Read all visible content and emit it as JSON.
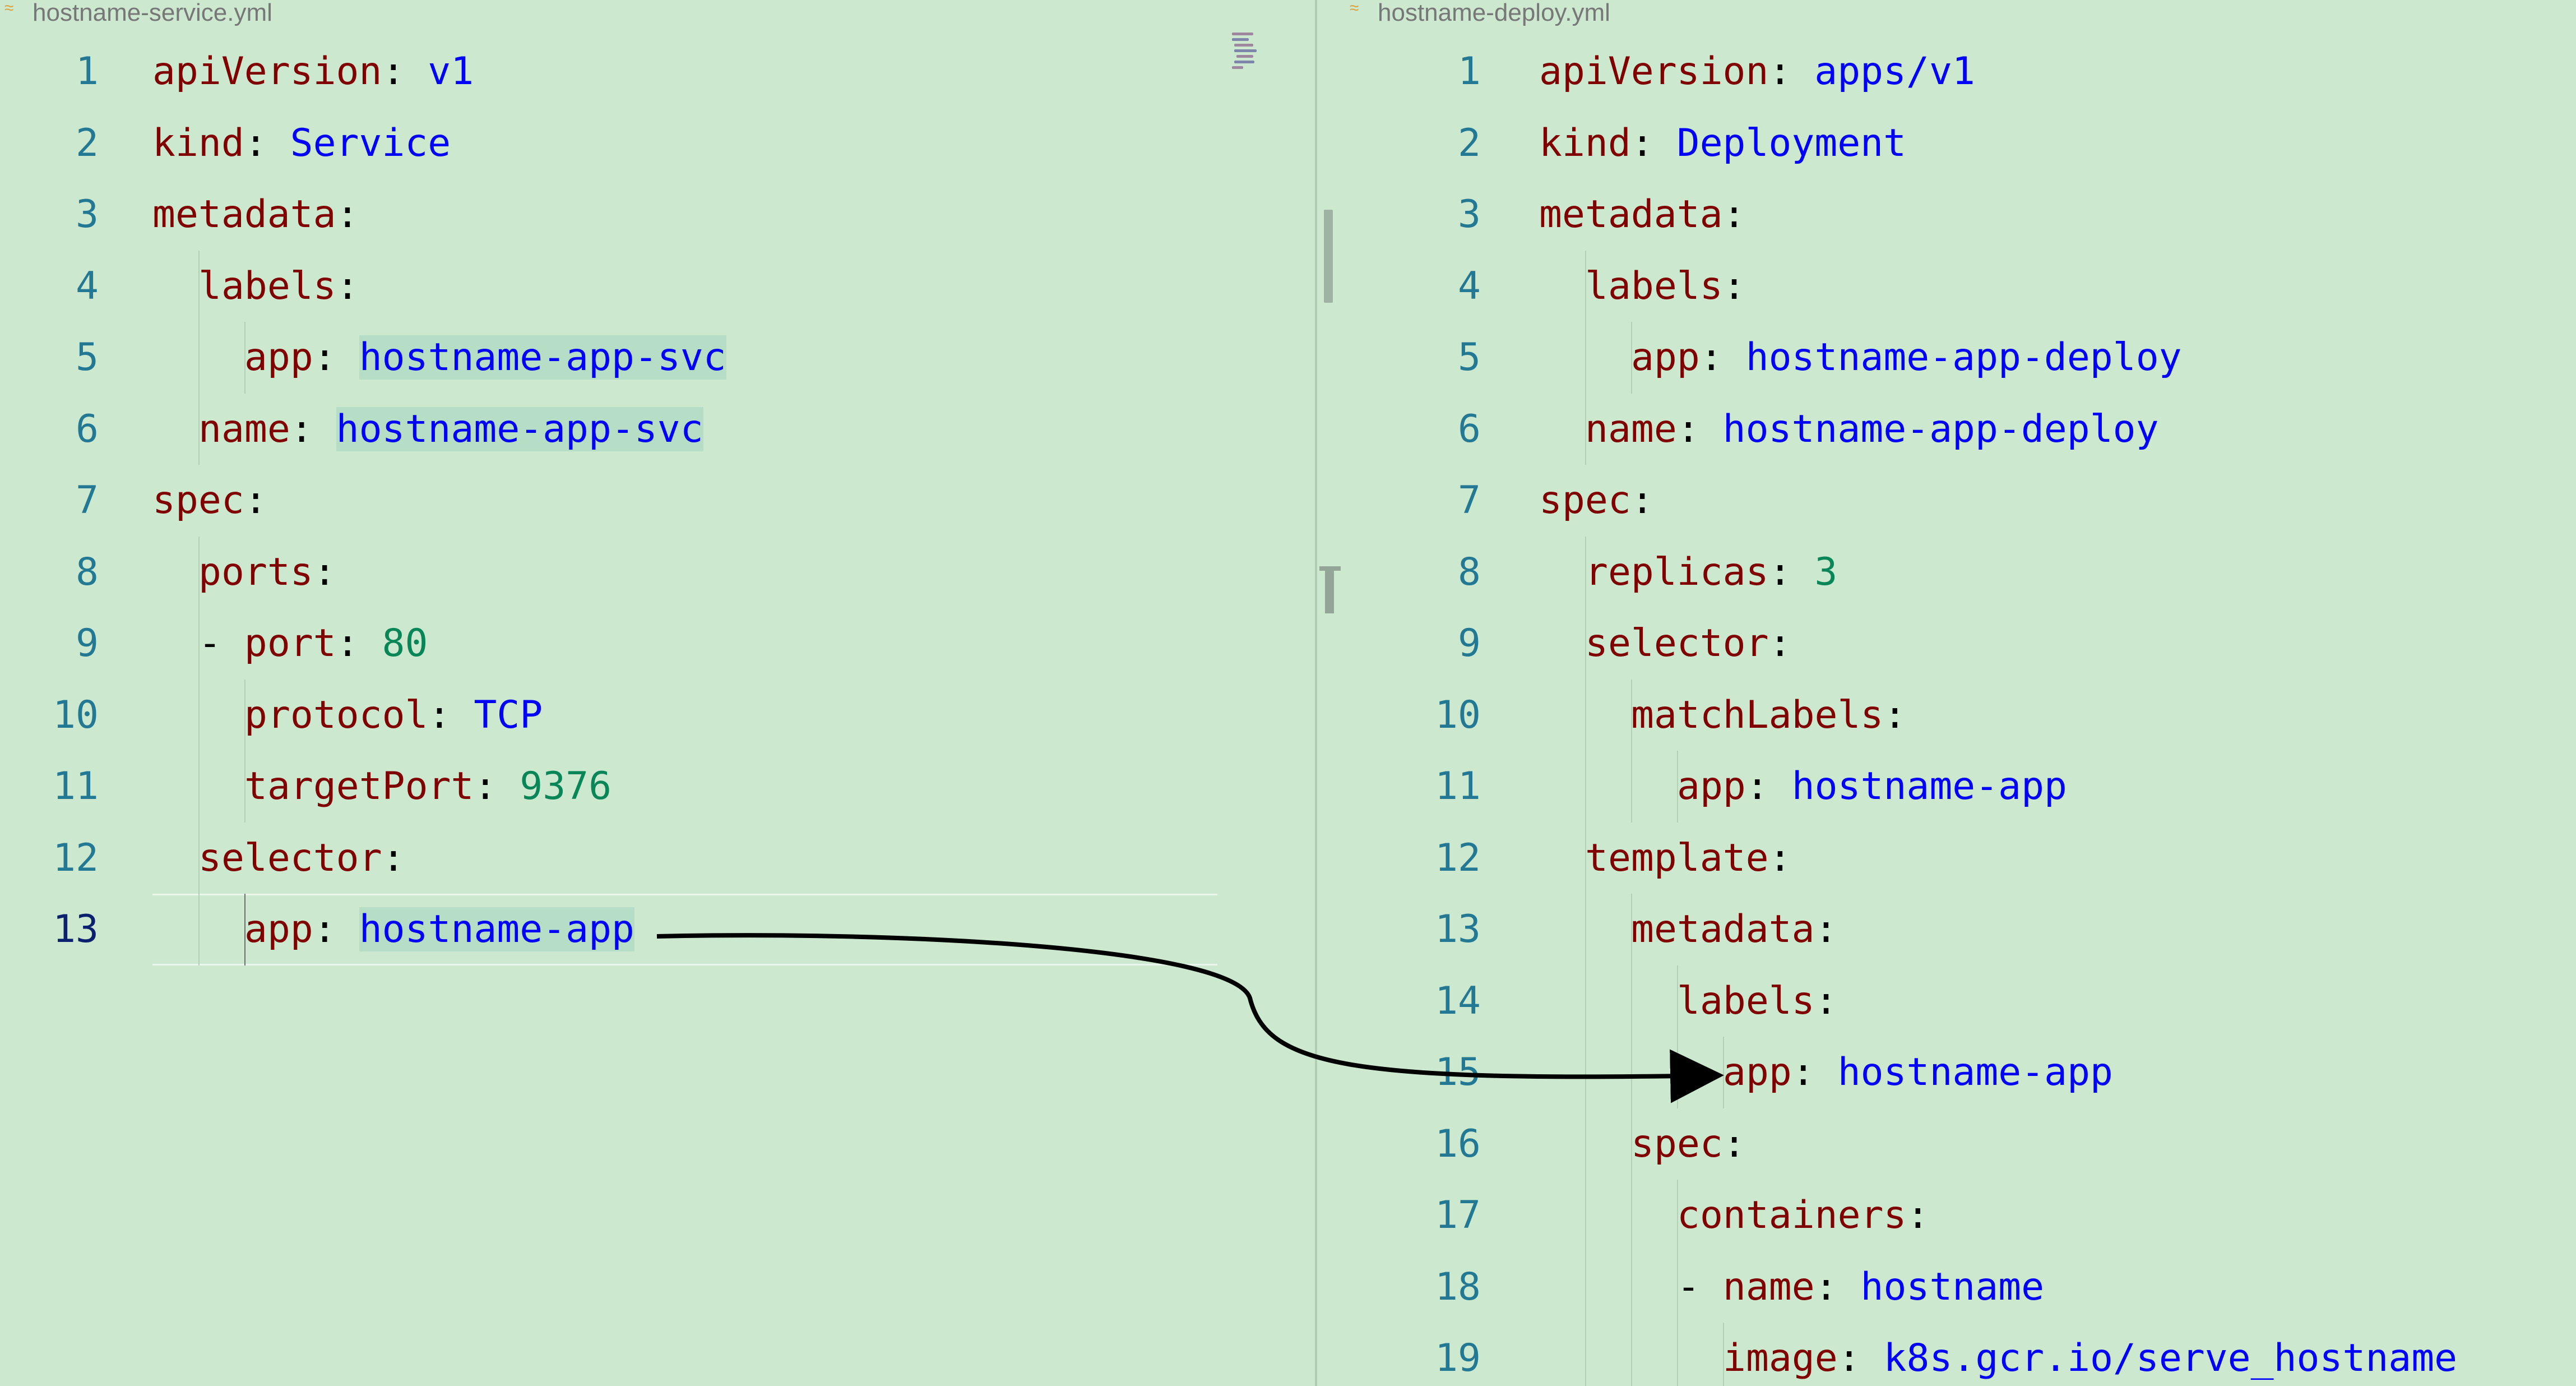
{
  "left": {
    "tab_title": "hostname-service.yml",
    "lines": [
      {
        "n": "1",
        "indent": 0,
        "tokens": [
          {
            "t": "apiVersion",
            "c": "k"
          },
          {
            "t": ": ",
            "c": "p"
          },
          {
            "t": "v1",
            "c": "s"
          }
        ]
      },
      {
        "n": "2",
        "indent": 0,
        "tokens": [
          {
            "t": "kind",
            "c": "k"
          },
          {
            "t": ": ",
            "c": "p"
          },
          {
            "t": "Service",
            "c": "s"
          }
        ]
      },
      {
        "n": "3",
        "indent": 0,
        "tokens": [
          {
            "t": "metadata",
            "c": "k"
          },
          {
            "t": ":",
            "c": "p"
          }
        ]
      },
      {
        "n": "4",
        "indent": 1,
        "tokens": [
          {
            "t": "labels",
            "c": "k"
          },
          {
            "t": ":",
            "c": "p"
          }
        ]
      },
      {
        "n": "5",
        "indent": 2,
        "tokens": [
          {
            "t": "app",
            "c": "k"
          },
          {
            "t": ": ",
            "c": "p"
          },
          {
            "t": "hostname-app-svc",
            "c": "s hl"
          }
        ]
      },
      {
        "n": "6",
        "indent": 1,
        "tokens": [
          {
            "t": "name",
            "c": "k"
          },
          {
            "t": ": ",
            "c": "p"
          },
          {
            "t": "hostname-app-svc",
            "c": "s hl"
          }
        ]
      },
      {
        "n": "7",
        "indent": 0,
        "tokens": [
          {
            "t": "spec",
            "c": "k"
          },
          {
            "t": ":",
            "c": "p"
          }
        ]
      },
      {
        "n": "8",
        "indent": 1,
        "tokens": [
          {
            "t": "ports",
            "c": "k"
          },
          {
            "t": ":",
            "c": "p"
          }
        ]
      },
      {
        "n": "9",
        "indent": 1,
        "tokens": [
          {
            "t": "- ",
            "c": "p"
          },
          {
            "t": "port",
            "c": "k"
          },
          {
            "t": ": ",
            "c": "p"
          },
          {
            "t": "80",
            "c": "n"
          }
        ]
      },
      {
        "n": "10",
        "indent": 2,
        "tokens": [
          {
            "t": "protocol",
            "c": "k"
          },
          {
            "t": ": ",
            "c": "p"
          },
          {
            "t": "TCP",
            "c": "s"
          }
        ]
      },
      {
        "n": "11",
        "indent": 2,
        "tokens": [
          {
            "t": "targetPort",
            "c": "k"
          },
          {
            "t": ": ",
            "c": "p"
          },
          {
            "t": "9376",
            "c": "n"
          }
        ]
      },
      {
        "n": "12",
        "indent": 1,
        "tokens": [
          {
            "t": "selector",
            "c": "k"
          },
          {
            "t": ":",
            "c": "p"
          }
        ]
      },
      {
        "n": "13",
        "indent": 2,
        "current": true,
        "tokens": [
          {
            "t": "app",
            "c": "k"
          },
          {
            "t": ": ",
            "c": "p"
          },
          {
            "t": "hostname-app",
            "c": "s hl"
          }
        ]
      }
    ]
  },
  "right": {
    "tab_title": "hostname-deploy.yml",
    "lines": [
      {
        "n": "1",
        "indent": 0,
        "tokens": [
          {
            "t": "apiVersion",
            "c": "k"
          },
          {
            "t": ": ",
            "c": "p"
          },
          {
            "t": "apps/v1",
            "c": "s"
          }
        ]
      },
      {
        "n": "2",
        "indent": 0,
        "tokens": [
          {
            "t": "kind",
            "c": "k"
          },
          {
            "t": ": ",
            "c": "p"
          },
          {
            "t": "Deployment",
            "c": "s"
          }
        ]
      },
      {
        "n": "3",
        "indent": 0,
        "tokens": [
          {
            "t": "metadata",
            "c": "k"
          },
          {
            "t": ":",
            "c": "p"
          }
        ]
      },
      {
        "n": "4",
        "indent": 1,
        "tokens": [
          {
            "t": "labels",
            "c": "k"
          },
          {
            "t": ":",
            "c": "p"
          }
        ]
      },
      {
        "n": "5",
        "indent": 2,
        "tokens": [
          {
            "t": "app",
            "c": "k"
          },
          {
            "t": ": ",
            "c": "p"
          },
          {
            "t": "hostname-app-deploy",
            "c": "s"
          }
        ]
      },
      {
        "n": "6",
        "indent": 1,
        "tokens": [
          {
            "t": "name",
            "c": "k"
          },
          {
            "t": ": ",
            "c": "p"
          },
          {
            "t": "hostname-app-deploy",
            "c": "s"
          }
        ]
      },
      {
        "n": "7",
        "indent": 0,
        "tokens": [
          {
            "t": "spec",
            "c": "k"
          },
          {
            "t": ":",
            "c": "p"
          }
        ]
      },
      {
        "n": "8",
        "indent": 1,
        "tokens": [
          {
            "t": "replicas",
            "c": "k"
          },
          {
            "t": ": ",
            "c": "p"
          },
          {
            "t": "3",
            "c": "n"
          }
        ]
      },
      {
        "n": "9",
        "indent": 1,
        "tokens": [
          {
            "t": "selector",
            "c": "k"
          },
          {
            "t": ":",
            "c": "p"
          }
        ]
      },
      {
        "n": "10",
        "indent": 2,
        "tokens": [
          {
            "t": "matchLabels",
            "c": "k"
          },
          {
            "t": ":",
            "c": "p"
          }
        ]
      },
      {
        "n": "11",
        "indent": 3,
        "tokens": [
          {
            "t": "app",
            "c": "k"
          },
          {
            "t": ": ",
            "c": "p"
          },
          {
            "t": "hostname-app",
            "c": "s"
          }
        ]
      },
      {
        "n": "12",
        "indent": 1,
        "tokens": [
          {
            "t": "template",
            "c": "k"
          },
          {
            "t": ":",
            "c": "p"
          }
        ]
      },
      {
        "n": "13",
        "indent": 2,
        "tokens": [
          {
            "t": "metadata",
            "c": "k"
          },
          {
            "t": ":",
            "c": "p"
          }
        ]
      },
      {
        "n": "14",
        "indent": 3,
        "tokens": [
          {
            "t": "labels",
            "c": "k"
          },
          {
            "t": ":",
            "c": "p"
          }
        ]
      },
      {
        "n": "15",
        "indent": 4,
        "tokens": [
          {
            "t": "app",
            "c": "k"
          },
          {
            "t": ": ",
            "c": "p"
          },
          {
            "t": "hostname-app",
            "c": "s"
          }
        ]
      },
      {
        "n": "16",
        "indent": 2,
        "tokens": [
          {
            "t": "spec",
            "c": "k"
          },
          {
            "t": ":",
            "c": "p"
          }
        ]
      },
      {
        "n": "17",
        "indent": 3,
        "tokens": [
          {
            "t": "containers",
            "c": "k"
          },
          {
            "t": ":",
            "c": "p"
          }
        ]
      },
      {
        "n": "18",
        "indent": 3,
        "tokens": [
          {
            "t": "- ",
            "c": "p"
          },
          {
            "t": "name",
            "c": "k"
          },
          {
            "t": ": ",
            "c": "p"
          },
          {
            "t": "hostname",
            "c": "s"
          }
        ]
      },
      {
        "n": "19",
        "indent": 4,
        "tokens": [
          {
            "t": "image",
            "c": "k"
          },
          {
            "t": ": ",
            "c": "p"
          },
          {
            "t": "k8s.gcr.io/serve_hostname",
            "c": "s"
          }
        ]
      }
    ]
  },
  "colors": {
    "background": "#cce8cf",
    "key": "#800000",
    "string": "#0000ff",
    "number": "#098658",
    "line_number": "#237893"
  },
  "icons": {
    "tab_icon": "yaml-file-icon"
  }
}
